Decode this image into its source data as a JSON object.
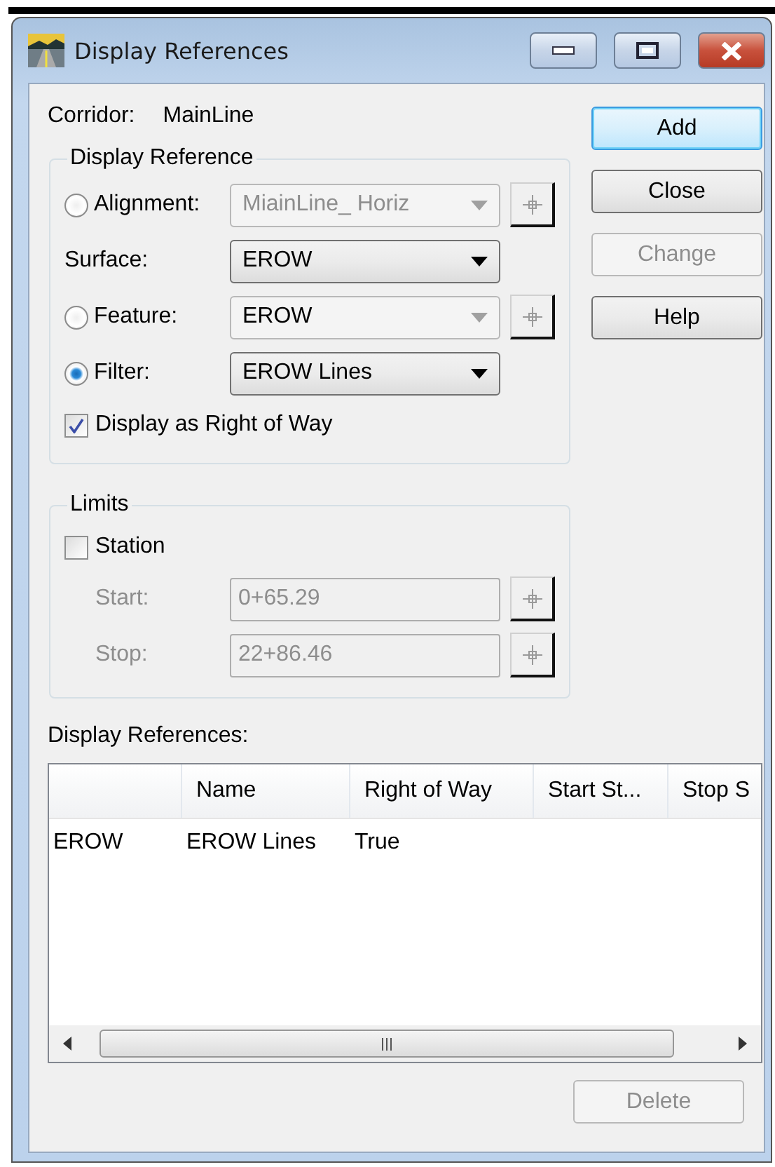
{
  "window": {
    "title": "Display References"
  },
  "corridor": {
    "label": "Corridor:",
    "value": "MainLine"
  },
  "display_reference": {
    "legend": "Display Reference",
    "rows": [
      {
        "kind": "radio",
        "label": "Alignment:",
        "selected": false,
        "combo": {
          "value": "MiainLine_ Horiz",
          "disabled": true,
          "value_greyed": true
        },
        "pick_button": true
      },
      {
        "kind": "label",
        "label": "Surface:",
        "combo": {
          "value": "EROW",
          "disabled": false,
          "value_greyed": false
        },
        "pick_button": false
      },
      {
        "kind": "radio",
        "label": "Feature:",
        "selected": false,
        "combo": {
          "value": "EROW",
          "disabled": true,
          "value_greyed": false
        },
        "pick_button": true
      },
      {
        "kind": "radio",
        "label": "Filter:",
        "selected": true,
        "combo": {
          "value": "EROW Lines",
          "disabled": false,
          "value_greyed": false
        },
        "pick_button": false
      }
    ],
    "checkbox": {
      "label": "Display as Right of Way",
      "checked": true
    }
  },
  "limits": {
    "legend": "Limits",
    "checkbox": {
      "label": "Station",
      "checked": false
    },
    "fields": [
      {
        "label": "Start:",
        "value": "0+65.29",
        "disabled": true
      },
      {
        "label": "Stop:",
        "value": "22+86.46",
        "disabled": true
      }
    ]
  },
  "buttons": [
    {
      "label": "Add",
      "default": true,
      "disabled": false
    },
    {
      "label": "Close",
      "default": false,
      "disabled": false
    },
    {
      "label": "Change",
      "default": false,
      "disabled": true
    },
    {
      "label": "Help",
      "default": false,
      "disabled": false
    }
  ],
  "list": {
    "label": "Display References:",
    "columns": [
      "",
      "Name",
      "Right of Way",
      "Start St...",
      "Stop S"
    ],
    "rows": [
      {
        "cells": [
          "EROW",
          "EROW Lines",
          "True"
        ]
      }
    ]
  },
  "delete_button": {
    "label": "Delete",
    "disabled": true
  }
}
